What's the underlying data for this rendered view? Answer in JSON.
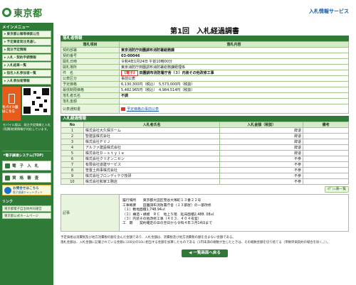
{
  "header": {
    "logo_text": "東京都",
    "service_title": "入札情報サービス"
  },
  "sidebar": {
    "menu_heading": "メインメニュー",
    "items": [
      {
        "label": "東京都公報等検索公告"
      },
      {
        "label": "予定業者発注見通し"
      },
      {
        "label": "発注予定情報"
      },
      {
        "label": "入札・契約手続情報"
      },
      {
        "label": "入札結果一覧"
      },
      {
        "label": "指名入札参加者一覧"
      },
      {
        "label": "入札参加者情報"
      }
    ],
    "mobile_label": "モバイル版はこちら",
    "mobile_note": "モバイル版は、発注予定情報と入札(見積)結果情報が対応しています。",
    "links_top": [
      {
        "label": "電子調達システム(TOP)"
      }
    ],
    "big_buttons": [
      {
        "label": "電 子 入 札"
      },
      {
        "label": "資 格 審 査"
      }
    ],
    "ask_title": "お問合せはこちら",
    "ask_sub": "電子調達チャットボット",
    "links_heading": "リンク",
    "links": [
      {
        "label": "東京都電子自治体共同運営"
      },
      {
        "label": "東京都公式ホームページ"
      }
    ]
  },
  "page": {
    "title": "第1回　入札経過調書",
    "tag": "件 名"
  },
  "bid_info": {
    "section_title": "落札者情報",
    "col_item": "落札項目",
    "col_content": "落札内容",
    "rows": [
      {
        "label": "契約部署",
        "value": "東京消防庁田園調布消防署総務課"
      },
      {
        "label": "契約番号",
        "value": "03-00046"
      },
      {
        "label": "開札日時",
        "value": "令和4年1月24日 午前10時00分"
      },
      {
        "label": "開札場所",
        "value": "東京消防庁田園調布消防署総務課経理係"
      }
    ],
    "kenmei_label": "件　名",
    "kenmei_tag": "【電子】",
    "kenmei_text": "田園調布消防署庁舎（３）内装その他改修工事",
    "rows2": [
      {
        "label": "公表区分",
        "value": "事前公表"
      },
      {
        "label": "予定価格",
        "value": "6,130,300円（税込）　5,573,000円（税抜）"
      },
      {
        "label": "最低制限価格",
        "value": "5,482,965円（税込）　4,984,514円（税抜）"
      },
      {
        "label": "落札者氏名",
        "value": "不調"
      },
      {
        "label": "落札金額",
        "value": ""
      }
    ],
    "notice_label": "公表通知書",
    "notice_link": "予定価格の事前公表"
  },
  "bidders": {
    "section_title": "入札経過情報",
    "col_no": "No",
    "col_name": "入札者氏名",
    "col_amount": "入札金額（税抜）",
    "col_remark": "備考",
    "rows": [
      {
        "no": "1",
        "name": "株式会社大久保ホーム",
        "amount": "",
        "remark": "辞退"
      },
      {
        "no": "2",
        "name": "智建設株式会社",
        "amount": "",
        "remark": "辞退"
      },
      {
        "no": "3",
        "name": "株式会社ＰＶＪ",
        "amount": "",
        "remark": "辞退"
      },
      {
        "no": "4",
        "name": "アルファ建設株式会社",
        "amount": "",
        "remark": "辞退"
      },
      {
        "no": "5",
        "name": "株式会社Ｄ－ｓｔｙｌｅ",
        "amount": "",
        "remark": "辞退"
      },
      {
        "no": "6",
        "name": "株式会社クリオンニセン",
        "amount": "",
        "remark": "不参"
      },
      {
        "no": "7",
        "name": "有限会社道建サービス",
        "amount": "",
        "remark": "不参"
      },
      {
        "no": "8",
        "name": "笹置土商事株式会社",
        "amount": "",
        "remark": "不参"
      },
      {
        "no": "9",
        "name": "株式会社ブロンディテク技研",
        "amount": "",
        "remark": "不参"
      },
      {
        "no": "10",
        "name": "株式会社和家工務店",
        "amount": "",
        "remark": "不参"
      }
    ],
    "history_button": "ﾊﾃﾞｼｭ表一覧"
  },
  "remarks": {
    "label": "記事",
    "lines": [
      "履行場所　　東京都大田区雪谷大塚町１３番２２号",
      "工事概要　　田園調布消防署庁舎（１３部屋）の一部改修",
      "（１）敷地面積1,748.94㎡",
      "（２）構造・規模　ＲＣ　地上５階　延床面積2,488. 08㎡",
      "（３）内装その他改修工事（４０３．４０４号室）",
      "工　期　　契約確定の日の翌日から令和４年３月14日まで"
    ]
  },
  "footnote": {
    "line1": "予定価格は消費税及び地方消費税の額を含んだ金額であり、入札金額は、消費税及び地方消費税の額を含まない金額である。",
    "line2": "落札金額は、入札金額に記載されている金額に100分の10に相当する金額を加算したものである（1円未満の端数が生じたときは、その端数金額を切り捨てる（単数単価契約の場合を除く。））。"
  },
  "back_button": "◀ 一覧画面へ戻る"
}
